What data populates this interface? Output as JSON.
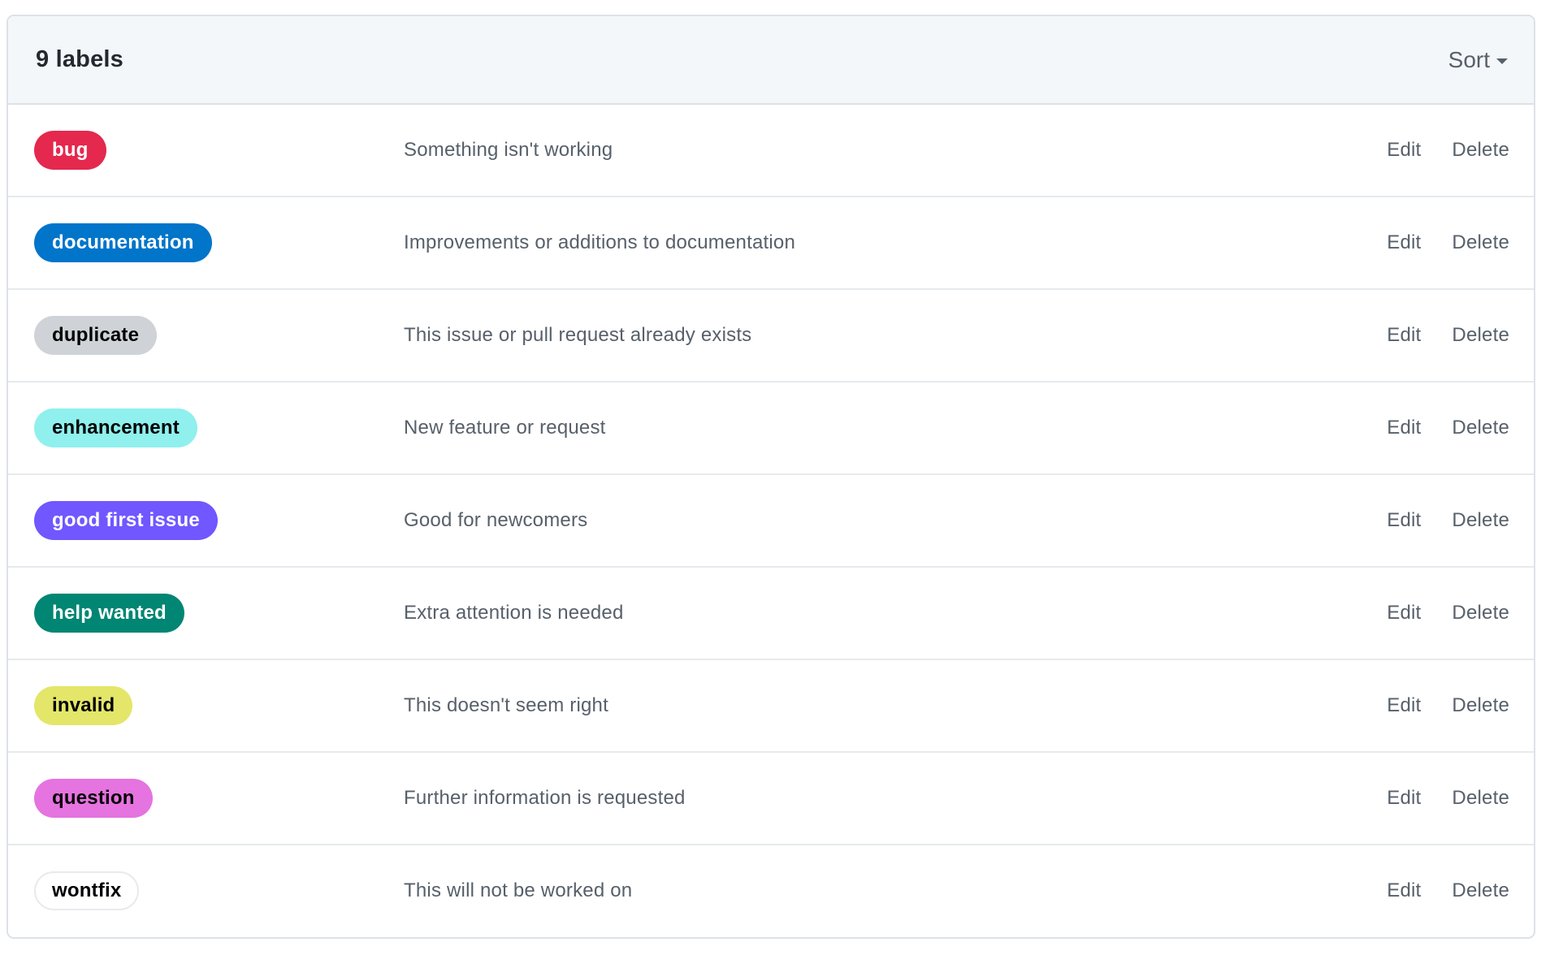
{
  "header": {
    "count_label": "9 labels",
    "sort_label": "Sort",
    "sort_icon": "caret-down-icon"
  },
  "labels": [
    {
      "name": "bug",
      "description": "Something isn't working",
      "color": "#e5284d",
      "text_color": "#ffffff"
    },
    {
      "name": "documentation",
      "description": "Improvements or additions to documentation",
      "color": "#0075ca",
      "text_color": "#ffffff"
    },
    {
      "name": "duplicate",
      "description": "This issue or pull request already exists",
      "color": "#cfd3d7",
      "text_color": "#000000"
    },
    {
      "name": "enhancement",
      "description": "New feature or request",
      "color": "#8ff0ee",
      "text_color": "#000000"
    },
    {
      "name": "good first issue",
      "description": "Good for newcomers",
      "color": "#7057ff",
      "text_color": "#ffffff"
    },
    {
      "name": "help wanted",
      "description": "Extra attention is needed",
      "color": "#008672",
      "text_color": "#ffffff"
    },
    {
      "name": "invalid",
      "description": "This doesn't seem right",
      "color": "#e4e669",
      "text_color": "#000000"
    },
    {
      "name": "question",
      "description": "Further information is requested",
      "color": "#e573e0",
      "text_color": "#000000"
    },
    {
      "name": "wontfix",
      "description": "This will not be worked on",
      "color": "#ffffff",
      "text_color": "#000000",
      "outlined": true
    }
  ],
  "actions": {
    "edit_label": "Edit",
    "delete_label": "Delete"
  }
}
